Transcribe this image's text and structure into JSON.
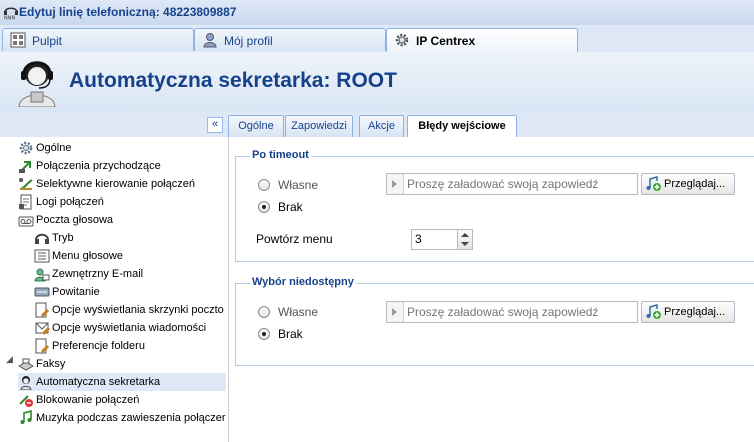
{
  "window": {
    "title": "Edytuj linię telefoniczną: 48223809887",
    "logo_icon": "app-logo-icon"
  },
  "top_tabs": [
    {
      "label": "Pulpit",
      "icon": "dashboard-icon"
    },
    {
      "label": "Mój profil",
      "icon": "user-icon"
    },
    {
      "label": "IP Centrex",
      "icon": "gear-icon"
    }
  ],
  "header": {
    "title": "Automatyczna sekretarka: ROOT",
    "icon": "operator-avatar-icon"
  },
  "inner_tabs": [
    {
      "label": "Ogólne"
    },
    {
      "label": "Zapowiedzi"
    },
    {
      "label": "Akcje"
    },
    {
      "label": "Błędy wejściowe"
    }
  ],
  "collapse_button": "«",
  "tree": {
    "items": [
      {
        "label": "Ogólne",
        "icon": "gear-icon"
      },
      {
        "label": "Połączenia przychodzące",
        "icon": "incoming-call-icon"
      },
      {
        "label": "Selektywne kierowanie połączeń",
        "icon": "routing-icon"
      },
      {
        "label": "Logi połączeń",
        "icon": "log-icon"
      },
      {
        "label": "Poczta głosowa",
        "icon": "voicemail-icon"
      },
      {
        "label": "Tryb",
        "icon": "mode-icon"
      },
      {
        "label": "Menu głosowe",
        "icon": "voice-menu-icon"
      },
      {
        "label": "Zewnętrzny E-mail",
        "icon": "email-icon"
      },
      {
        "label": "Powitanie",
        "icon": "greeting-icon"
      },
      {
        "label": "Opcje wyświetlania skrzynki poczto",
        "icon": "mailbox-options-icon"
      },
      {
        "label": "Opcje wyświetlania wiadomości",
        "icon": "message-options-icon"
      },
      {
        "label": "Preferencje folderu",
        "icon": "folder-icon"
      },
      {
        "label": "Faksy",
        "icon": "fax-icon"
      },
      {
        "label": "Automatyczna sekretarka",
        "icon": "auto-attendant-icon"
      },
      {
        "label": "Blokowanie połączeń",
        "icon": "call-block-icon"
      },
      {
        "label": "Muzyka podczas zawieszenia połączer",
        "icon": "hold-music-icon"
      }
    ],
    "expander": "◢"
  },
  "panel": {
    "timeout": {
      "legend": "Po timeout",
      "option_custom": "Własne",
      "option_none": "Brak",
      "selected": "Brak",
      "file_placeholder": "Proszę załadować swoją zapowiedź",
      "browse_label": "Przeglądaj...",
      "repeat_label": "Powtórz menu",
      "repeat_value": "3"
    },
    "unavailable": {
      "legend": "Wybór niedostępny",
      "option_custom": "Własne",
      "option_none": "Brak",
      "selected": "Brak",
      "file_placeholder": "Proszę załadować swoją zapowiedź",
      "browse_label": "Przeglądaj..."
    }
  }
}
